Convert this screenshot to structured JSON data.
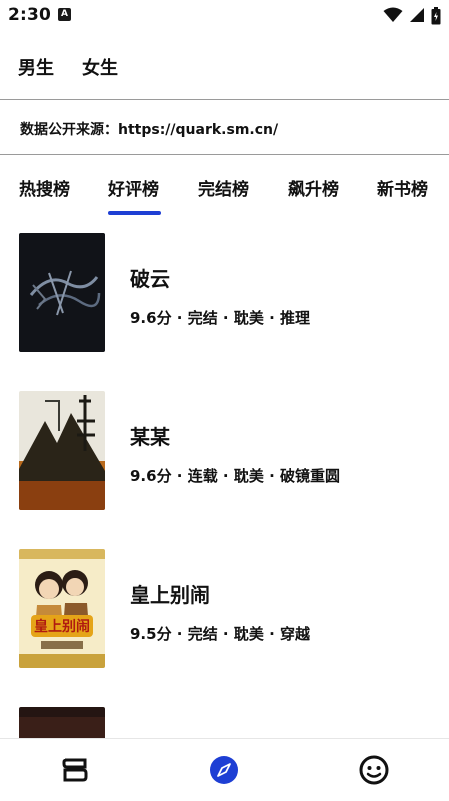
{
  "status_bar": {
    "time": "2:30",
    "notification_badge": "A",
    "icons": [
      "wifi-icon",
      "cell-signal-icon",
      "battery-icon"
    ]
  },
  "gender_tabs": [
    "男生",
    "女生"
  ],
  "source": {
    "text": "数据公开来源：https://quark.sm.cn/"
  },
  "rank_tabs": [
    {
      "label": "热搜榜",
      "selected": false
    },
    {
      "label": "好评榜",
      "selected": true
    },
    {
      "label": "完结榜",
      "selected": false
    },
    {
      "label": "飙升榜",
      "selected": false
    },
    {
      "label": "新书榜",
      "selected": false
    }
  ],
  "accent_color": "#1e3fd4",
  "books": [
    {
      "title": "破云",
      "meta": "9.6分 · 完结 · 耽美 · 推理"
    },
    {
      "title": "某某",
      "meta": "9.6分 · 连载 · 耽美 · 破镜重圆"
    },
    {
      "title": "皇上别闹",
      "meta": "9.5分 · 完结 · 耽美 · 穿越"
    }
  ],
  "bottom_nav": [
    {
      "icon": "bookshelf-icon"
    },
    {
      "icon": "discover-compass-icon",
      "active": true
    },
    {
      "icon": "profile-smile-icon"
    }
  ]
}
